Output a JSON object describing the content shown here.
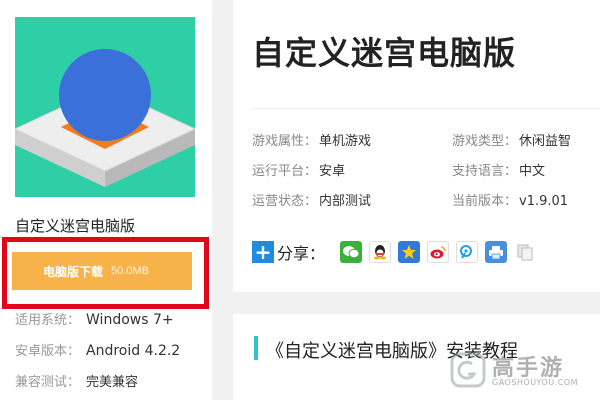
{
  "app": {
    "name": "自定义迷宫电脑版",
    "icon": "maze-ball-game-icon"
  },
  "download": {
    "label": "电脑版下载",
    "size": "50.0MB"
  },
  "meta": [
    {
      "label": "适用系统：",
      "value": "Windows 7+"
    },
    {
      "label": "安卓版本：",
      "value": "Android 4.2.2"
    },
    {
      "label": "兼容测试：",
      "value": "完美兼容"
    }
  ],
  "info": {
    "title": "自定义迷宫电脑版",
    "attrs": [
      {
        "label": "游戏属性：",
        "value": "单机游戏"
      },
      {
        "label": "游戏类型：",
        "value": "休闲益智"
      },
      {
        "label": "运行平台：",
        "value": "安卓"
      },
      {
        "label": "支持语言：",
        "value": "中文"
      },
      {
        "label": "运营状态：",
        "value": "内部测试"
      },
      {
        "label": "当前版本：",
        "value": "v1.9.01"
      }
    ]
  },
  "share": {
    "label": "分享：",
    "icons": [
      "wechat-icon",
      "qq-icon",
      "qzone-star-icon",
      "weibo-icon",
      "tencent-weibo-icon",
      "print-icon",
      "copy-icon"
    ]
  },
  "tutorial": {
    "title": "《自定义迷宫电脑版》安装教程"
  },
  "watermark": {
    "brand": "高手游",
    "url": "GAOSHOUYOU.COM"
  },
  "colors": {
    "icon_bg": "#2ecfa6",
    "download": "#f7b24a",
    "highlight_frame": "#e3061a",
    "accent": "#2bc5ce"
  }
}
